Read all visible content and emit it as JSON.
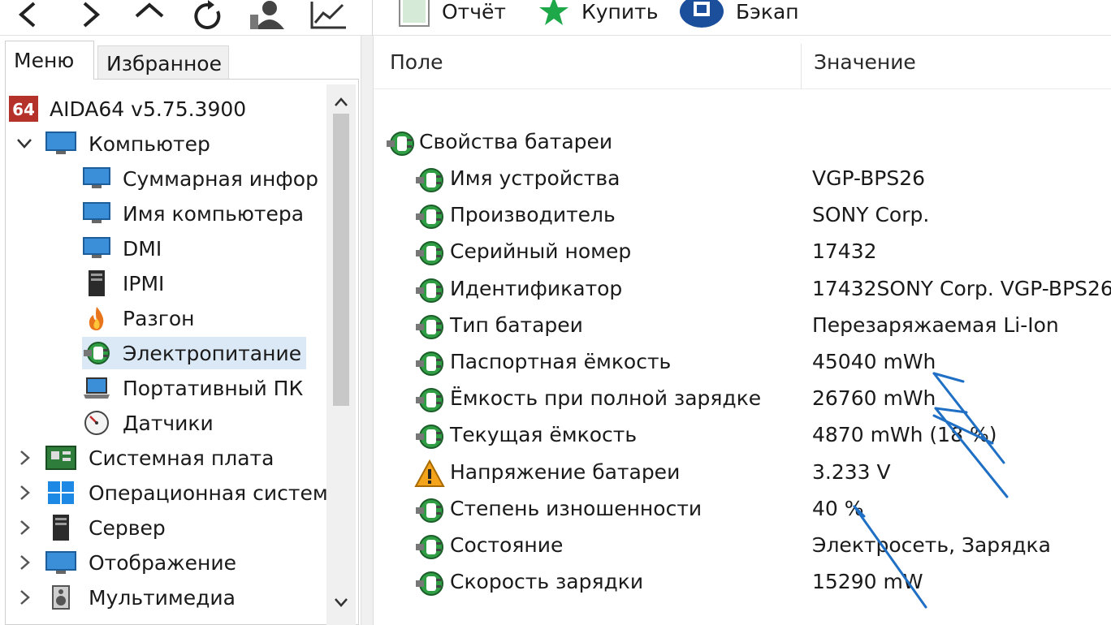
{
  "toolbar": {
    "nav_icons": [
      "back-icon",
      "forward-icon",
      "up-icon",
      "refresh-icon",
      "user-icon",
      "chart-icon"
    ],
    "report_label": "Отчёт",
    "buy_label": "Купить",
    "backup_label": "Бэкап"
  },
  "left_panel": {
    "tabs": [
      {
        "label": "Меню",
        "active": true
      },
      {
        "label": "Избранное",
        "active": false
      }
    ],
    "tree": [
      {
        "label": "AIDA64 v5.75.3900",
        "icon": "aida64-icon",
        "level": 0,
        "expander": "none",
        "badge": "64"
      },
      {
        "label": "Компьютер",
        "icon": "computer-icon",
        "level": 0,
        "expander": "expanded"
      },
      {
        "label": "Суммарная инфор",
        "icon": "monitor-icon",
        "level": 1
      },
      {
        "label": "Имя компьютера",
        "icon": "monitor-icon",
        "level": 1
      },
      {
        "label": "DMI",
        "icon": "monitor-icon",
        "level": 1
      },
      {
        "label": "IPMI",
        "icon": "server-icon",
        "level": 1
      },
      {
        "label": "Разгон",
        "icon": "flame-icon",
        "level": 1
      },
      {
        "label": "Электропитание",
        "icon": "power-plug-icon",
        "level": 1,
        "selected": true
      },
      {
        "label": "Портативный ПК",
        "icon": "laptop-icon",
        "level": 1
      },
      {
        "label": "Датчики",
        "icon": "gauge-icon",
        "level": 1
      },
      {
        "label": "Системная плата",
        "icon": "motherboard-icon",
        "level": 0,
        "expander": "collapsed"
      },
      {
        "label": "Операционная систем",
        "icon": "windows-icon",
        "level": 0,
        "expander": "collapsed"
      },
      {
        "label": "Сервер",
        "icon": "server-icon",
        "level": 0,
        "expander": "collapsed"
      },
      {
        "label": "Отображение",
        "icon": "display-icon",
        "level": 0,
        "expander": "collapsed"
      },
      {
        "label": "Мультимедиа",
        "icon": "speaker-icon",
        "level": 0,
        "expander": "collapsed"
      }
    ]
  },
  "right_panel": {
    "columns": {
      "field": "Поле",
      "value": "Значение"
    },
    "group": {
      "label": "Свойства батареи",
      "icon": "power-plug-icon"
    },
    "rows": [
      {
        "name": "Имя устройства",
        "value": "VGP-BPS26",
        "icon": "power-plug-icon"
      },
      {
        "name": "Производитель",
        "value": "SONY Corp.",
        "icon": "power-plug-icon"
      },
      {
        "name": "Серийный номер",
        "value": "17432",
        "icon": "power-plug-icon"
      },
      {
        "name": "Идентификатор",
        "value": "17432SONY Corp. VGP-BPS26",
        "icon": "power-plug-icon"
      },
      {
        "name": "Тип батареи",
        "value": "Перезаряжаемая Li-Ion",
        "icon": "power-plug-icon"
      },
      {
        "name": "Паспортная ёмкость",
        "value": "45040 mWh",
        "icon": "power-plug-icon"
      },
      {
        "name": "Ёмкость при полной зарядке",
        "value": "26760 mWh",
        "icon": "power-plug-icon"
      },
      {
        "name": "Текущая ёмкость",
        "value": "4870 mWh  (18 %)",
        "icon": "power-plug-icon"
      },
      {
        "name": "Напряжение батареи",
        "value": "3.233 V",
        "icon": "warning-icon"
      },
      {
        "name": "Степень изношенности",
        "value": "40 %",
        "icon": "power-plug-icon"
      },
      {
        "name": "Состояние",
        "value": "Электросеть, Зарядка",
        "icon": "power-plug-icon"
      },
      {
        "name": "Скорость зарядки",
        "value": "15290 mW",
        "icon": "power-plug-icon"
      }
    ]
  },
  "colors": {
    "selection": "#dbe9f7",
    "annotation_ink": "#1f6fc4",
    "aida_red": "#b5322b"
  }
}
